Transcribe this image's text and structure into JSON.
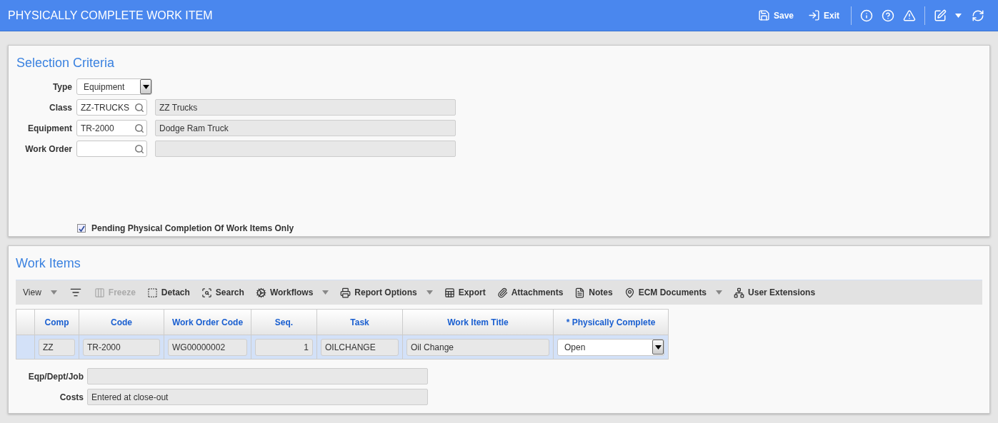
{
  "header": {
    "title": "PHYSICALLY COMPLETE WORK ITEM",
    "actions": [
      {
        "label": "Save"
      },
      {
        "label": "Exit"
      }
    ]
  },
  "selection": {
    "title": "Selection Criteria",
    "fields": [
      {
        "label": "Type",
        "kind": "select",
        "value": "Equipment"
      },
      {
        "label": "Class",
        "kind": "lookup",
        "value": "ZZ-TRUCKS",
        "description": "ZZ Trucks"
      },
      {
        "label": "Equipment",
        "kind": "lookup",
        "value": "TR-2000",
        "description": "Dodge Ram Truck"
      },
      {
        "label": "Work Order",
        "kind": "lookup"
      }
    ],
    "checkbox": {
      "label": "Pending Physical Completion Of Work Items Only",
      "checked": true
    }
  },
  "work_items": {
    "title": "Work Items",
    "toolbar": [
      {
        "label": "View",
        "kind": "menu",
        "disabled": false,
        "caret": true
      },
      {
        "kind": "icon",
        "disabled": false,
        "caret": false
      },
      {
        "label": "Freeze",
        "kind": "button",
        "disabled": true,
        "caret": false
      },
      {
        "label": "Detach",
        "kind": "button",
        "disabled": false,
        "caret": false
      },
      {
        "label": "Search",
        "kind": "button",
        "disabled": false,
        "caret": false
      },
      {
        "label": "Workflows",
        "kind": "button",
        "disabled": false,
        "caret": true
      },
      {
        "label": "Report Options",
        "kind": "button",
        "disabled": false,
        "caret": true
      },
      {
        "label": "Export",
        "kind": "button",
        "disabled": false,
        "caret": false
      },
      {
        "label": "Attachments",
        "kind": "button",
        "disabled": false,
        "caret": false
      },
      {
        "label": "Notes",
        "kind": "button",
        "disabled": false,
        "caret": false
      },
      {
        "label": "ECM Documents",
        "kind": "button",
        "disabled": false,
        "caret": true
      },
      {
        "label": "User Extensions",
        "kind": "button",
        "disabled": false,
        "caret": false
      }
    ],
    "table": {
      "columns": [
        "Comp",
        "Code",
        "Work Order Code",
        "Seq.",
        "Task",
        "Work Item Title",
        "* Physically Complete"
      ],
      "rows": [
        {
          "selected": true,
          "cells": [
            {
              "kind": "text",
              "value": "ZZ"
            },
            {
              "kind": "text",
              "value": "TR-2000"
            },
            {
              "kind": "text",
              "value": "WG00000002"
            },
            {
              "kind": "number",
              "value": "1"
            },
            {
              "kind": "text",
              "value": "OILCHANGE"
            },
            {
              "kind": "text",
              "value": "Oil Change"
            },
            {
              "kind": "select",
              "value": "Open"
            }
          ]
        }
      ]
    },
    "fields": [
      {
        "label": "Eqp/Dept/Job"
      },
      {
        "label": "Costs",
        "value": "Entered at close-out"
      }
    ]
  }
}
